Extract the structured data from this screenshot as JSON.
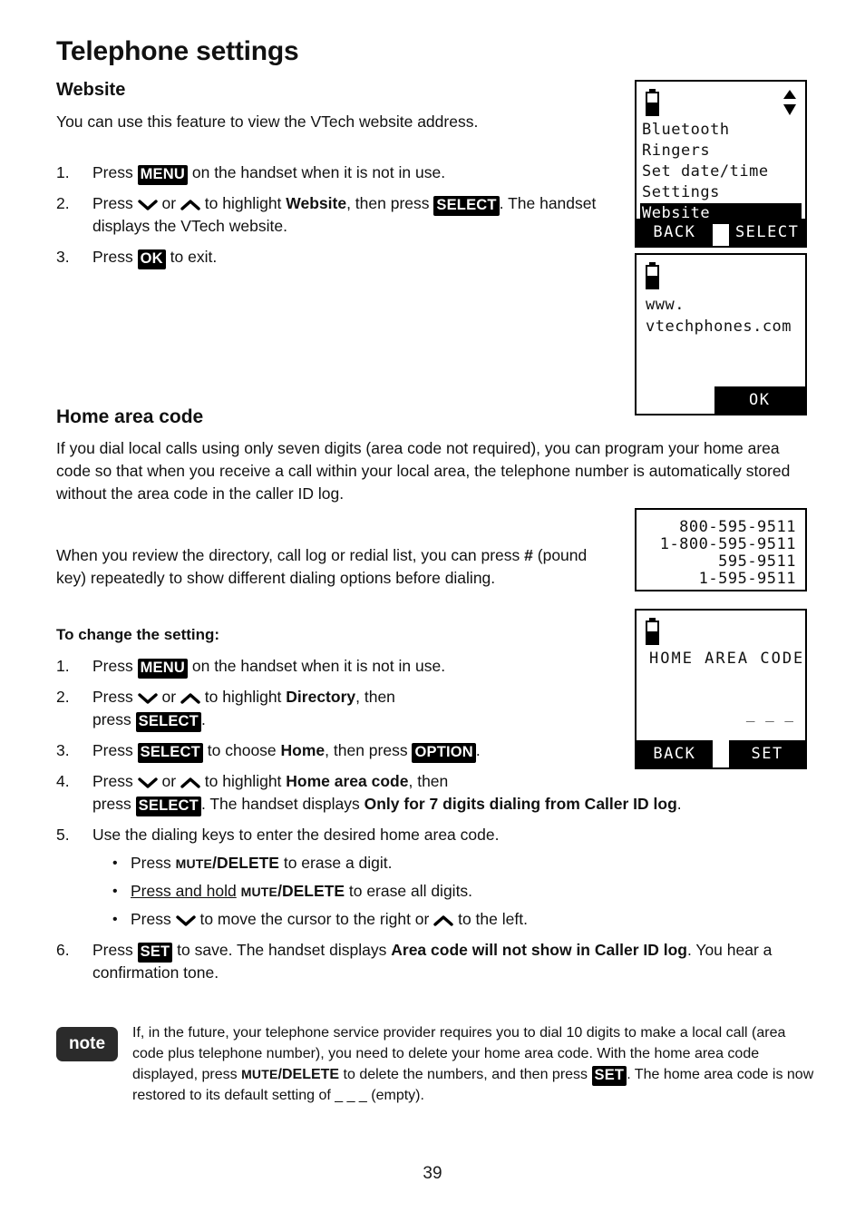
{
  "document": {
    "title": "Telephone settings",
    "page_number": "39"
  },
  "website_section": {
    "heading": "Website",
    "intro": "You can use this feature to view the VTech website address.",
    "steps": [
      {
        "num": "1.",
        "parts": [
          {
            "t": "text",
            "v": "Press "
          },
          {
            "t": "key",
            "v": "MENU"
          },
          {
            "t": "text",
            "v": " on the handset when it is not in use."
          }
        ]
      },
      {
        "num": "2.",
        "parts": [
          {
            "t": "text",
            "v": "Press "
          },
          {
            "t": "icon",
            "v": "chevron-down-icon"
          },
          {
            "t": "text",
            "v": " or "
          },
          {
            "t": "icon",
            "v": "chevron-up-icon"
          },
          {
            "t": "text",
            "v": " to highlight "
          },
          {
            "t": "bold",
            "v": "Website"
          },
          {
            "t": "text",
            "v": ", then press "
          },
          {
            "t": "key",
            "v": "SELECT"
          },
          {
            "t": "text",
            "v": ". The handset displays the VTech website."
          }
        ]
      },
      {
        "num": "3.",
        "parts": [
          {
            "t": "text",
            "v": "Press "
          },
          {
            "t": "key",
            "v": "OK"
          },
          {
            "t": "text",
            "v": " to exit."
          }
        ]
      }
    ]
  },
  "home_area_code_section": {
    "heading": "Home area code",
    "paragraph_1": "If you dial local calls using only seven digits (area code not required), you can program your home area code so that when you receive a call within your local area, the telephone number is automatically stored without the area code in the caller ID log.",
    "paragraph_2_parts": [
      {
        "t": "text",
        "v": "When you review the directory, call log or redial list, you can press "
      },
      {
        "t": "bold",
        "v": "#"
      },
      {
        "t": "text",
        "v": " (pound key) repeatedly to show different dialing options before dialing."
      }
    ],
    "subheading": "To change the setting:",
    "steps": [
      {
        "num": "1.",
        "parts": [
          {
            "t": "text",
            "v": "Press "
          },
          {
            "t": "key",
            "v": "MENU"
          },
          {
            "t": "text",
            "v": " on the handset when it is not in use."
          }
        ]
      },
      {
        "num": "2.",
        "parts": [
          {
            "t": "text",
            "v": "Press "
          },
          {
            "t": "icon",
            "v": "chevron-down-icon"
          },
          {
            "t": "text",
            "v": " or "
          },
          {
            "t": "icon",
            "v": "chevron-up-icon"
          },
          {
            "t": "text",
            "v": " to highlight "
          },
          {
            "t": "bold",
            "v": "Directory"
          },
          {
            "t": "text",
            "v": ", then"
          },
          {
            "t": "br",
            "v": ""
          },
          {
            "t": "text",
            "v": "press "
          },
          {
            "t": "key",
            "v": "SELECT"
          },
          {
            "t": "text",
            "v": "."
          }
        ]
      },
      {
        "num": "3.",
        "parts": [
          {
            "t": "text",
            "v": "Press "
          },
          {
            "t": "key",
            "v": "SELECT"
          },
          {
            "t": "text",
            "v": " to choose "
          },
          {
            "t": "bold",
            "v": "Home"
          },
          {
            "t": "text",
            "v": ", then press "
          },
          {
            "t": "key",
            "v": "OPTION"
          },
          {
            "t": "text",
            "v": "."
          }
        ]
      },
      {
        "num": "4.",
        "parts": [
          {
            "t": "text",
            "v": "Press "
          },
          {
            "t": "icon",
            "v": "chevron-down-icon"
          },
          {
            "t": "text",
            "v": " or "
          },
          {
            "t": "icon",
            "v": "chevron-up-icon"
          },
          {
            "t": "text",
            "v": " to highlight "
          },
          {
            "t": "bold",
            "v": "Home area code"
          },
          {
            "t": "text",
            "v": ", then"
          },
          {
            "t": "br",
            "v": ""
          },
          {
            "t": "text",
            "v": "press "
          },
          {
            "t": "key",
            "v": "SELECT"
          },
          {
            "t": "text",
            "v": ". The handset displays "
          },
          {
            "t": "bold",
            "v": "Only for 7 digits dialing from Caller ID log"
          },
          {
            "t": "text",
            "v": "."
          }
        ]
      },
      {
        "num": "5.",
        "parts": [
          {
            "t": "text",
            "v": "Use the dialing keys to enter the desired home area code."
          }
        ],
        "bullets": [
          [
            {
              "t": "text",
              "v": "Press "
            },
            {
              "t": "smallcaps",
              "v": "MUTE"
            },
            {
              "t": "bold",
              "v": "/DELETE"
            },
            {
              "t": "text",
              "v": " to erase a digit."
            }
          ],
          [
            {
              "t": "underline",
              "v": "Press and hold"
            },
            {
              "t": "text",
              "v": " "
            },
            {
              "t": "smallcaps",
              "v": "MUTE"
            },
            {
              "t": "bold",
              "v": "/DELETE"
            },
            {
              "t": "text",
              "v": " to erase all digits."
            }
          ],
          [
            {
              "t": "text",
              "v": "Press "
            },
            {
              "t": "icon",
              "v": "chevron-down-icon"
            },
            {
              "t": "text",
              "v": " to move the cursor to the right or "
            },
            {
              "t": "icon",
              "v": "chevron-up-icon"
            },
            {
              "t": "text",
              "v": " to the left."
            }
          ]
        ]
      },
      {
        "num": "6.",
        "parts": [
          {
            "t": "text",
            "v": "Press "
          },
          {
            "t": "key",
            "v": "SET"
          },
          {
            "t": "text",
            "v": " to save. The handset displays "
          },
          {
            "t": "bold",
            "v": "Area code will not show in Caller ID log"
          },
          {
            "t": "text",
            "v": ". You hear a confirmation tone."
          }
        ]
      }
    ]
  },
  "note": {
    "badge_label": "note",
    "parts": [
      {
        "t": "text",
        "v": "If, in the future, your telephone service provider requires you to dial 10 digits to make a local call (area code plus telephone number), you need to delete your home area code. With the home area code displayed, press "
      },
      {
        "t": "smallcaps",
        "v": "MUTE"
      },
      {
        "t": "bold",
        "v": "/DELETE"
      },
      {
        "t": "text",
        "v": " to delete the numbers, and then press "
      },
      {
        "t": "key",
        "v": "SET"
      },
      {
        "t": "text",
        "v": ". The home area code is now restored to its default setting of _ _ _ (empty)."
      }
    ]
  },
  "screens": {
    "menu_screen": {
      "battery_icon": "battery-half-icon",
      "scroll_icon": "scroll-up-down-icon",
      "rows": [
        {
          "label": "Bluetooth",
          "selected": false
        },
        {
          "label": "Ringers",
          "selected": false
        },
        {
          "label": "Set date/time",
          "selected": false
        },
        {
          "label": "Settings",
          "selected": false
        },
        {
          "label": "Website",
          "selected": true
        }
      ],
      "softkey_left": "BACK",
      "softkey_right": "SELECT"
    },
    "website_screen": {
      "battery_icon": "battery-half-icon",
      "line_1": "www.",
      "line_2": "vtechphones.com",
      "softkey_right": "OK"
    },
    "numbers_screen": {
      "lines": [
        "800-595-9511",
        "1-800-595-9511",
        "595-9511",
        "1-595-9511"
      ]
    },
    "home_area_code_screen": {
      "battery_icon": "battery-half-icon",
      "title": "HOME AREA CODE",
      "field_value": "_ _ _",
      "softkey_left": "BACK",
      "softkey_right": "SET"
    }
  },
  "colors": {
    "ink": "#111111",
    "badge_bg": "#000000",
    "note_badge_bg": "#2b2b2b",
    "paper": "#ffffff"
  }
}
